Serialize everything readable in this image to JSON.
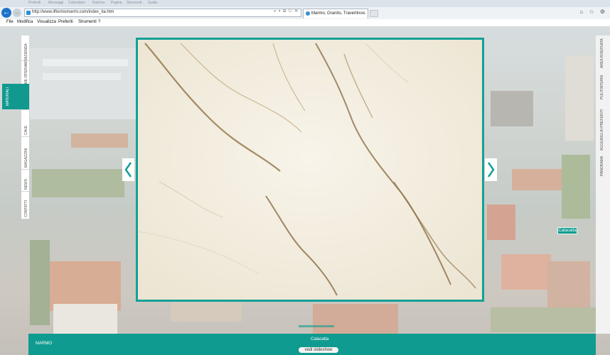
{
  "browser": {
    "top_items": [
      "Preferiti",
      "Messaggi",
      "Calendario",
      "Rubrica",
      "Pagina",
      "Strumenti",
      "Guida"
    ],
    "url": "http://www.ilfiorinomarmi.com/index_ita.htm",
    "tab_title": "Marmo, Granito, Travertino...",
    "address_controls": "⌕ ▾ ⊟ ↻ ✕",
    "right_icons": "⌂ ☆ ⚙",
    "back_icon": "back-arrow-icon",
    "forward_icon": "forward-arrow-icon"
  },
  "menu": {
    "items": [
      "File",
      "Modifica",
      "Visualizza",
      "Preferiti",
      "Strumenti",
      "?"
    ]
  },
  "side_nav": {
    "items": [
      "AZIENDA",
      "COME OPERIAMO",
      "MATERIALI",
      "CAVE",
      "MAGAZZINI",
      "NEWS",
      "CONTATTI"
    ],
    "active": "MATERIALI"
  },
  "right_nav": {
    "items": [
      "AREA RISERVATA",
      "PULITINTERNI",
      "AGGIUNGI AI PREFERITI",
      "PANORAMA"
    ]
  },
  "gallery": {
    "label_tag": "Calacatta",
    "prev_icon": "chevron-left-icon",
    "next_icon": "chevron-right-icon"
  },
  "footer": {
    "category": "MARMO",
    "material_name": "Calacatta",
    "slideshow_label": "vedi slideshow"
  },
  "colors": {
    "accent": "#109b90",
    "browser_blue": "#1d73c9"
  }
}
